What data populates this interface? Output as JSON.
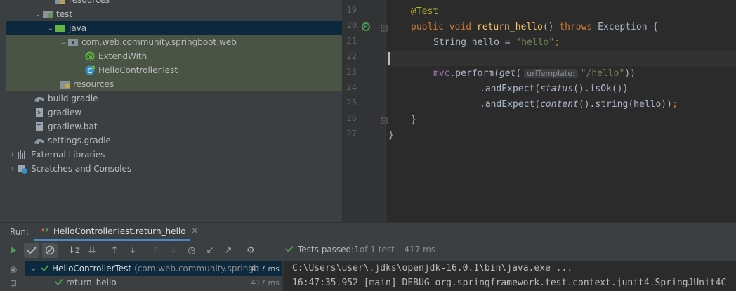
{
  "project_tree": {
    "items": [
      {
        "label": "resources"
      },
      {
        "label": "test"
      },
      {
        "label": "java"
      },
      {
        "label": "com.web.community.springboot.web"
      },
      {
        "label": "ExtendWith"
      },
      {
        "label": "HelloControllerTest"
      },
      {
        "label": "resources"
      },
      {
        "label": "build.gradle"
      },
      {
        "label": "gradlew"
      },
      {
        "label": "gradlew.bat"
      },
      {
        "label": "settings.gradle"
      },
      {
        "label": "External Libraries"
      },
      {
        "label": "Scratches and Consoles"
      }
    ]
  },
  "editor": {
    "line_numbers": [
      "19",
      "20",
      "21",
      "22",
      "23",
      "24",
      "25",
      "26",
      "27"
    ],
    "code": {
      "l19": {
        "annotation": "@Test"
      },
      "l20": {
        "kw1": "public void ",
        "fn": "return_hello",
        "p1": "() ",
        "kw2": "throws ",
        "p2": "Exception {"
      },
      "l21": {
        "p1": "String hello = ",
        "str": "\"hello\"",
        "p2": ";"
      },
      "l23": {
        "field": "mvc",
        "p1": ".perform(",
        "call": "get",
        "p2": "(",
        "hint": "urlTemplate:",
        "str": "\"/hello\"",
        "p3": "))"
      },
      "l24": {
        "p1": ".andExpect(",
        "call": "status",
        "p2": "().isOk())"
      },
      "l25": {
        "p1": ".andExpect(",
        "call": "content",
        "p2": "().string(hello))",
        "semi": ";"
      },
      "l26": {
        "p1": "}"
      },
      "l27": {
        "p1": "}"
      }
    }
  },
  "run_panel": {
    "run_label": "Run:",
    "tab_label": "HelloControllerTest.return_hello",
    "status": {
      "prefix": "Tests passed: ",
      "count": "1",
      "suffix": " of 1 test – 417 ms"
    },
    "tests": [
      {
        "name": "HelloControllerTest",
        "package": "(com.web.community.springboot",
        "time": "417 ms"
      },
      {
        "name": "return_hello",
        "time": "417 ms"
      }
    ],
    "console": [
      "C:\\Users\\user\\.jdks\\openjdk-16.0.1\\bin\\java.exe ...",
      "16:47:35.952 [main] DEBUG org.springframework.test.context.junit4.SpringJUnit4C"
    ]
  },
  "colors": {
    "pass_green": "#499c54",
    "selection": "#0d293e",
    "highlight": "#4a5444"
  }
}
